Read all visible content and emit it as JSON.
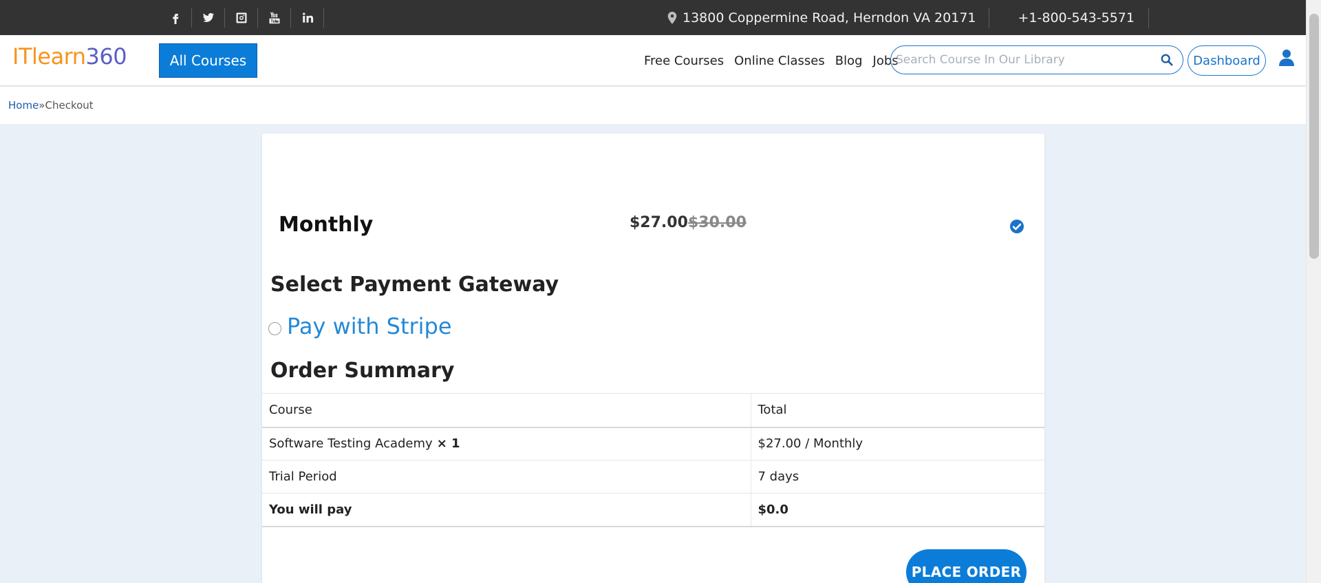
{
  "topbar": {
    "social": [
      "facebook-icon",
      "twitter-icon",
      "instagram-icon",
      "youtube-icon",
      "linkedin-icon"
    ],
    "address": "13800 Coppermine Road, Herndon VA 20171",
    "phone": "+1-800-543-5571"
  },
  "header": {
    "logo_part1": "ITlearn",
    "logo_part2": "360",
    "all_courses": "All Courses",
    "nav": [
      "Free Courses",
      "Online Classes",
      "Blog",
      "Jobs"
    ],
    "search_placeholder": "Search Course In Our Library",
    "dashboard": "Dashboard"
  },
  "breadcrumb": {
    "home": "Home",
    "sep": " » ",
    "current": "Checkout"
  },
  "plan": {
    "name": "Monthly",
    "price": "$27.00",
    "old_price": "$30.00",
    "selected": true
  },
  "gateway": {
    "title": "Select Payment Gateway",
    "option": "Pay with Stripe"
  },
  "summary": {
    "title": "Order Summary",
    "headers": [
      "Course",
      "Total"
    ],
    "item_name": "Software Testing Academy",
    "item_qty": "× 1",
    "item_total": "$27.00 / Monthly",
    "trial_label": "Trial Period",
    "trial_value": "7 days",
    "pay_label": "You will pay",
    "pay_value": "$0.0"
  },
  "place_order": "PLACE ORDER",
  "colors": {
    "accent": "#0b7dd9",
    "topbar": "#333333",
    "background": "#eaf0f8"
  }
}
